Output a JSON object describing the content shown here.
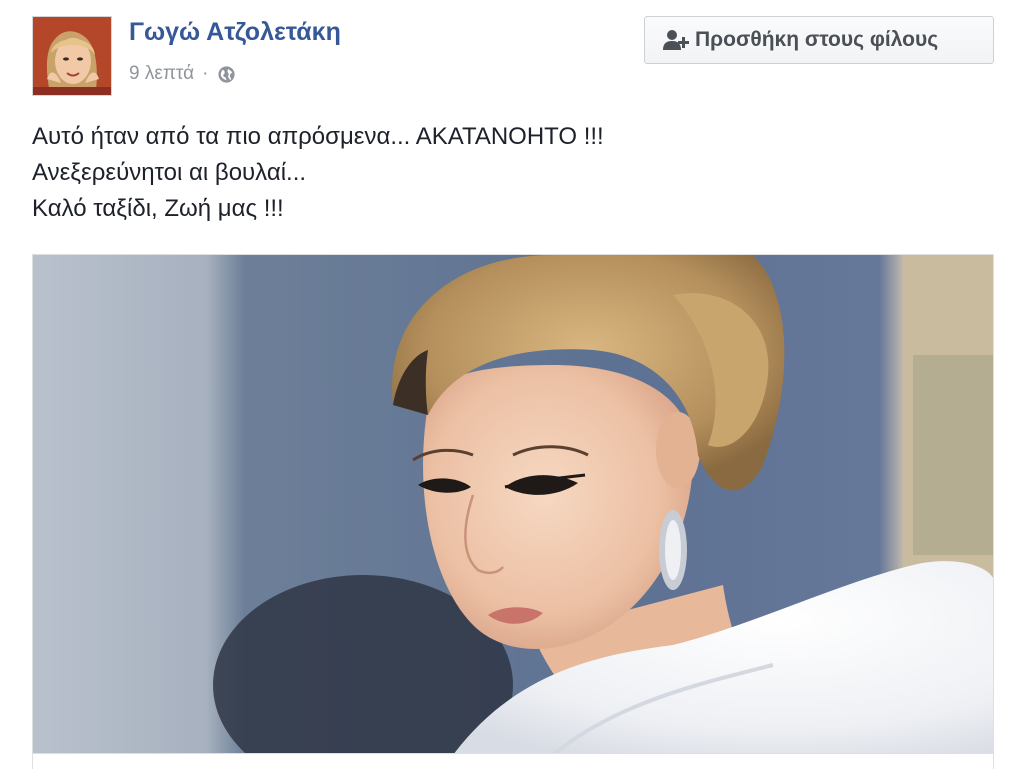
{
  "post": {
    "author_name": "Γωγώ Ατζολετάκη",
    "timestamp": "9 λεπτά",
    "separator": "·",
    "privacy_icon": "globe-icon",
    "add_friend_label": "Προσθήκη στους φίλους",
    "add_friend_icon": "add-friend-icon",
    "text_lines": [
      "Αυτό ήταν από τα πιο απρόσμενα... ΑΚΑΤΑΝΟΗΤΟ !!!",
      "Ανεξερεύνητοι αι βουλαί...",
      "Καλό ταξίδι, Ζωή μας !!!"
    ]
  },
  "colors": {
    "author_link": "#365899",
    "meta_gray": "#90949c",
    "body_text": "#1d2129",
    "button_text": "#4b4f56",
    "button_border": "#cdd0d4"
  }
}
